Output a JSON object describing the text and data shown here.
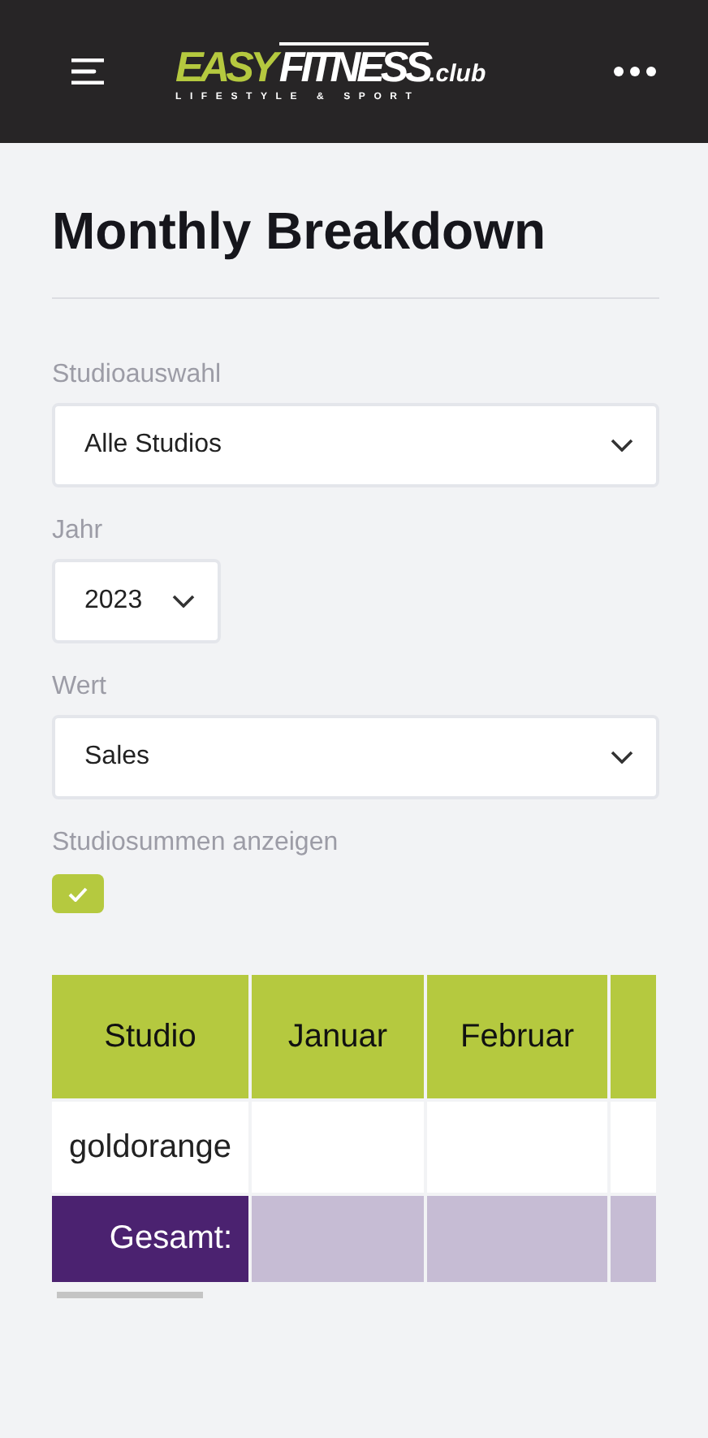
{
  "header": {
    "logo": {
      "word_1": "EASY",
      "word_2": "FITNESS",
      "suffix": ".club",
      "tagline": "LIFESTYLE & SPORT"
    }
  },
  "title": "Monthly Breakdown",
  "filters": [
    {
      "kind": "select",
      "label": "Studioauswahl",
      "value": "Alle Studios",
      "wide": true
    },
    {
      "kind": "select",
      "label": "Jahr",
      "value": "2023",
      "wide": false
    },
    {
      "kind": "select",
      "label": "Wert",
      "value": "Sales",
      "wide": true
    },
    {
      "kind": "checkbox",
      "label": "Studiosummen anzeigen",
      "checked": true
    }
  ],
  "table": {
    "columns": [
      "Studio",
      "Januar",
      "Februar",
      ""
    ],
    "rows": [
      {
        "kind": "studio",
        "cells": [
          "goldorange",
          "",
          "",
          ""
        ]
      },
      {
        "kind": "total",
        "cells": [
          "Gesamt:",
          "",
          "",
          ""
        ]
      }
    ]
  }
}
